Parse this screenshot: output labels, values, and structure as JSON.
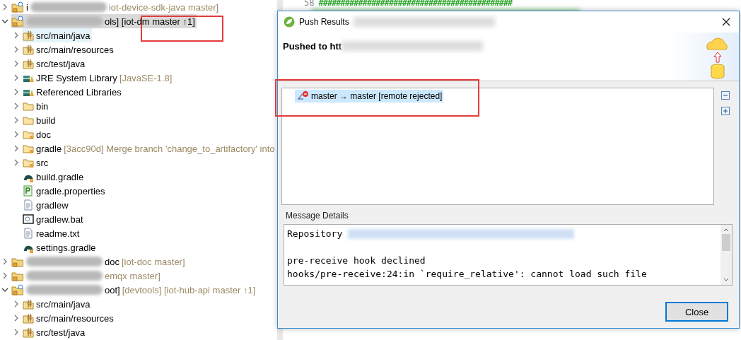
{
  "editor": {
    "lines": [
      {
        "number": "58",
        "text": "############################################"
      }
    ]
  },
  "tree": [
    {
      "kind": "project",
      "label": "i",
      "redacted": true,
      "decoration": "iot-device-sdk-java master]",
      "expanded": false,
      "selected": false,
      "hovered": false
    },
    {
      "kind": "project",
      "redacted": true,
      "label_tail": "ols] [iot-dm master ↑1]",
      "expanded": true,
      "selected": true,
      "hovered": false,
      "children": [
        {
          "kind": "source-folder",
          "label": "src/main/java",
          "expanded": false,
          "selected": false,
          "hovered": true
        },
        {
          "kind": "source-folder",
          "label": "src/main/resources",
          "expanded": false,
          "selected": false,
          "hovered": false
        },
        {
          "kind": "source-folder",
          "label": "src/test/java",
          "expanded": false,
          "selected": false,
          "hovered": false
        },
        {
          "kind": "library",
          "label": "JRE System Library",
          "decoration": "[JavaSE-1.8]",
          "expanded": false,
          "selected": false,
          "hovered": false
        },
        {
          "kind": "library",
          "label": "Referenced Libraries",
          "expanded": false,
          "selected": false,
          "hovered": false
        },
        {
          "kind": "folder",
          "label": "bin",
          "expanded": false,
          "selected": false,
          "hovered": false
        },
        {
          "kind": "folder",
          "label": "build",
          "expanded": false,
          "selected": false,
          "hovered": false
        },
        {
          "kind": "tracked-folder",
          "label": "doc",
          "expanded": false,
          "selected": false,
          "hovered": false
        },
        {
          "kind": "tracked-folder",
          "label": "gradle",
          "decoration": "[3acc90d] Merge branch 'change_to_artifactory' into",
          "expanded": false,
          "selected": false,
          "hovered": false
        },
        {
          "kind": "tracked-folder",
          "label": "src",
          "expanded": false,
          "selected": false,
          "hovered": false
        },
        {
          "kind": "gradle-file",
          "label": "build.gradle",
          "selected": false,
          "hovered": false
        },
        {
          "kind": "properties-file",
          "label": "gradle.properties",
          "selected": false,
          "hovered": false
        },
        {
          "kind": "text-file",
          "label": "gradlew",
          "selected": false,
          "hovered": false
        },
        {
          "kind": "script-file",
          "label": "gradlew.bat",
          "selected": false,
          "hovered": false
        },
        {
          "kind": "text-file",
          "label": "readme.txt",
          "selected": false,
          "hovered": false
        },
        {
          "kind": "gradle-file",
          "label": "settings.gradle",
          "selected": false,
          "hovered": false
        }
      ]
    },
    {
      "kind": "plain-project",
      "redacted": true,
      "label_tail": "doc",
      "decoration": "[iot-doc master]",
      "expanded": false,
      "selected": false,
      "hovered": false
    },
    {
      "kind": "plain-project",
      "redacted": true,
      "decoration": "emqx master]",
      "expanded": false,
      "selected": false,
      "hovered": false
    },
    {
      "kind": "project",
      "redacted": true,
      "label_tail": "oot]",
      "decoration": "[devtools] [iot-hub-api master ↑1]",
      "expanded": true,
      "selected": false,
      "hovered": false,
      "children": [
        {
          "kind": "source-folder",
          "label": "src/main/java",
          "expanded": false,
          "selected": false,
          "hovered": false
        },
        {
          "kind": "source-folder",
          "label": "src/main/resources",
          "expanded": false,
          "selected": false,
          "hovered": false
        },
        {
          "kind": "source-folder",
          "label": "src/test/java",
          "expanded": false,
          "selected": false,
          "hovered": false
        }
      ]
    }
  ],
  "dialog": {
    "title": "Push Results",
    "heading": "Pushed to htt",
    "results": [
      {
        "label": "master → master [remote rejected]",
        "selected": true
      }
    ],
    "details_label": "Message Details",
    "details_paragraphs": [
      [
        "Repository"
      ],
      [
        "pre-receive hook declined",
        "hooks/pre-receive:24:in `require_relative': cannot load such file"
      ]
    ],
    "buttons": [
      "Close"
    ]
  }
}
